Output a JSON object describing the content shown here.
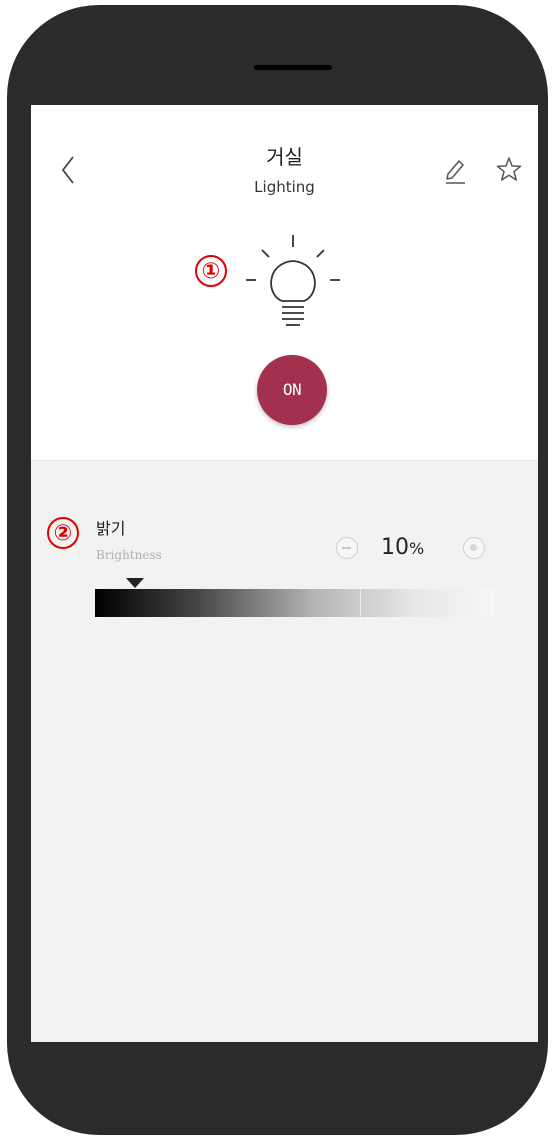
{
  "header": {
    "title": "거실",
    "subtitle": "Lighting",
    "back_icon": "chevron-left-icon",
    "edit_icon": "pencil-icon",
    "favorite_icon": "star-icon"
  },
  "annotations": {
    "marker_1": "①",
    "marker_2": "②"
  },
  "power": {
    "label": "ON",
    "color": "#a3304c"
  },
  "brightness": {
    "label": "밝기",
    "sublabel": "Brightness",
    "value": "10",
    "unit": "%",
    "level": 0.1
  }
}
